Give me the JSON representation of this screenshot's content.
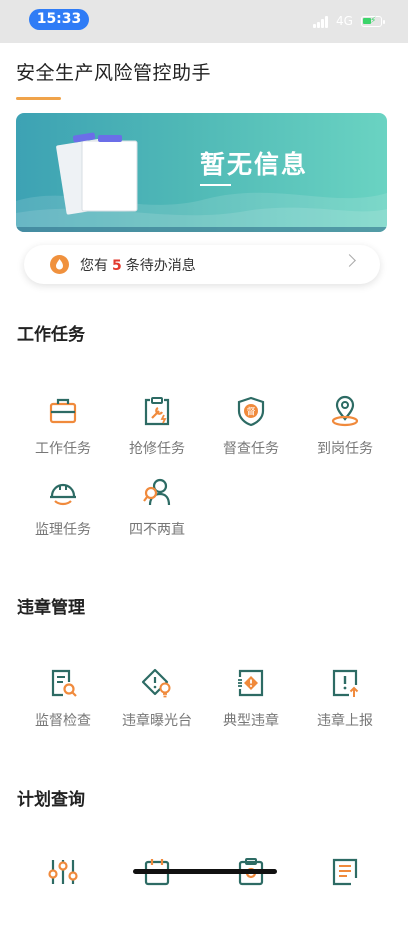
{
  "status_bar": {
    "time": "15:33",
    "network": "4G"
  },
  "header": {
    "title": "安全生产风险管控助手"
  },
  "banner": {
    "text": "暂无信息"
  },
  "notice": {
    "prefix": "您有",
    "count": "5",
    "suffix": "条待办消息"
  },
  "sections": [
    {
      "title": "工作任务",
      "items": [
        {
          "label": "工作任务",
          "icon": "briefcase-icon"
        },
        {
          "label": "抢修任务",
          "icon": "repair-clipboard-icon"
        },
        {
          "label": "督查任务",
          "icon": "shield-badge-icon"
        },
        {
          "label": "到岗任务",
          "icon": "location-pin-icon"
        },
        {
          "label": "监理任务",
          "icon": "hard-hat-icon"
        },
        {
          "label": "四不两直",
          "icon": "inspector-search-icon"
        }
      ]
    },
    {
      "title": "违章管理",
      "items": [
        {
          "label": "监督检查",
          "icon": "document-search-icon"
        },
        {
          "label": "违章曝光台",
          "icon": "warning-bulb-icon"
        },
        {
          "label": "典型违章",
          "icon": "warning-frame-icon"
        },
        {
          "label": "违章上报",
          "icon": "report-upload-icon"
        }
      ]
    },
    {
      "title": "计划查询",
      "items": [
        {
          "label": "",
          "icon": "sliders-icon"
        },
        {
          "label": "",
          "icon": "calendar-icon"
        },
        {
          "label": "",
          "icon": "clipboard-check-icon"
        },
        {
          "label": "",
          "icon": "document-list-icon"
        }
      ]
    }
  ],
  "colors": {
    "accent": "#f0a34a",
    "icon_dark": "#2d6b64",
    "icon_orange": "#f08a3c",
    "status_pill": "#2f7cf6"
  }
}
